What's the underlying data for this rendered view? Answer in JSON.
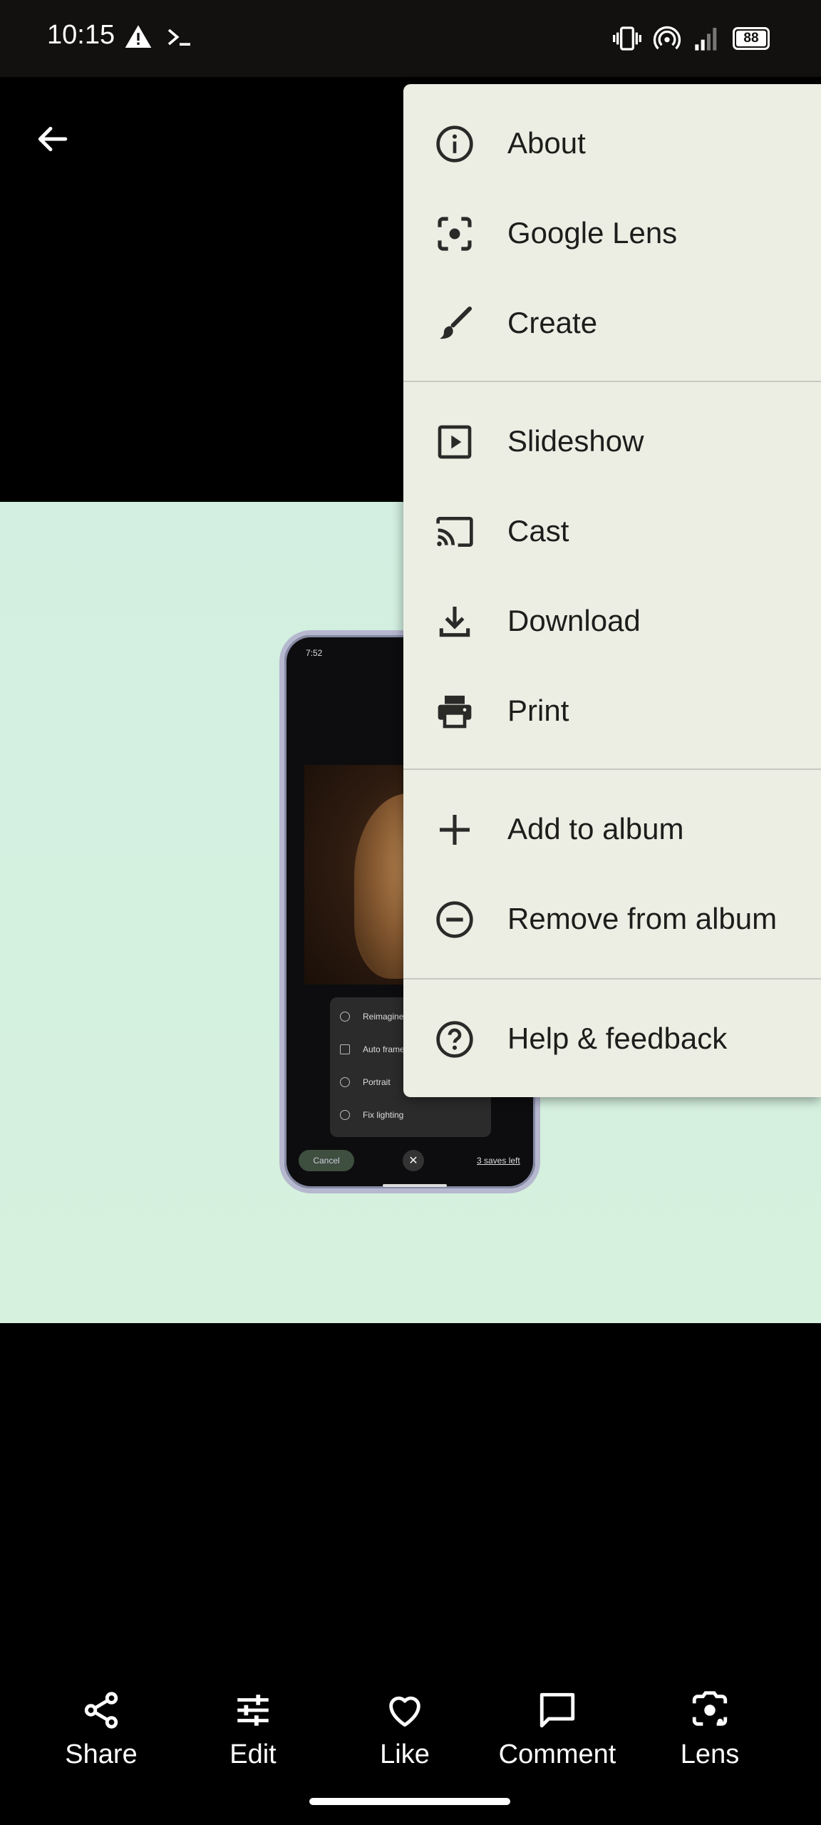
{
  "status_bar": {
    "time": "10:15",
    "battery": "88"
  },
  "phone_screenshot": {
    "status_time": "7:52",
    "menu_items": [
      "Reimagine",
      "Auto frame",
      "Portrait",
      "Fix lighting"
    ],
    "cancel_label": "Cancel",
    "saves_left": "3 saves left"
  },
  "menu": {
    "about": "About",
    "google_lens": "Google Lens",
    "create": "Create",
    "slideshow": "Slideshow",
    "cast": "Cast",
    "download": "Download",
    "print": "Print",
    "add_to_album": "Add to album",
    "remove_from_album": "Remove from album",
    "help_feedback": "Help & feedback"
  },
  "bottom_bar": {
    "share": "Share",
    "edit": "Edit",
    "like": "Like",
    "comment": "Comment",
    "lens": "Lens"
  },
  "colors": {
    "menu_bg": "#eceee4",
    "photo_bg": "#d4f0df",
    "status_bar_bg": "#12110f"
  }
}
